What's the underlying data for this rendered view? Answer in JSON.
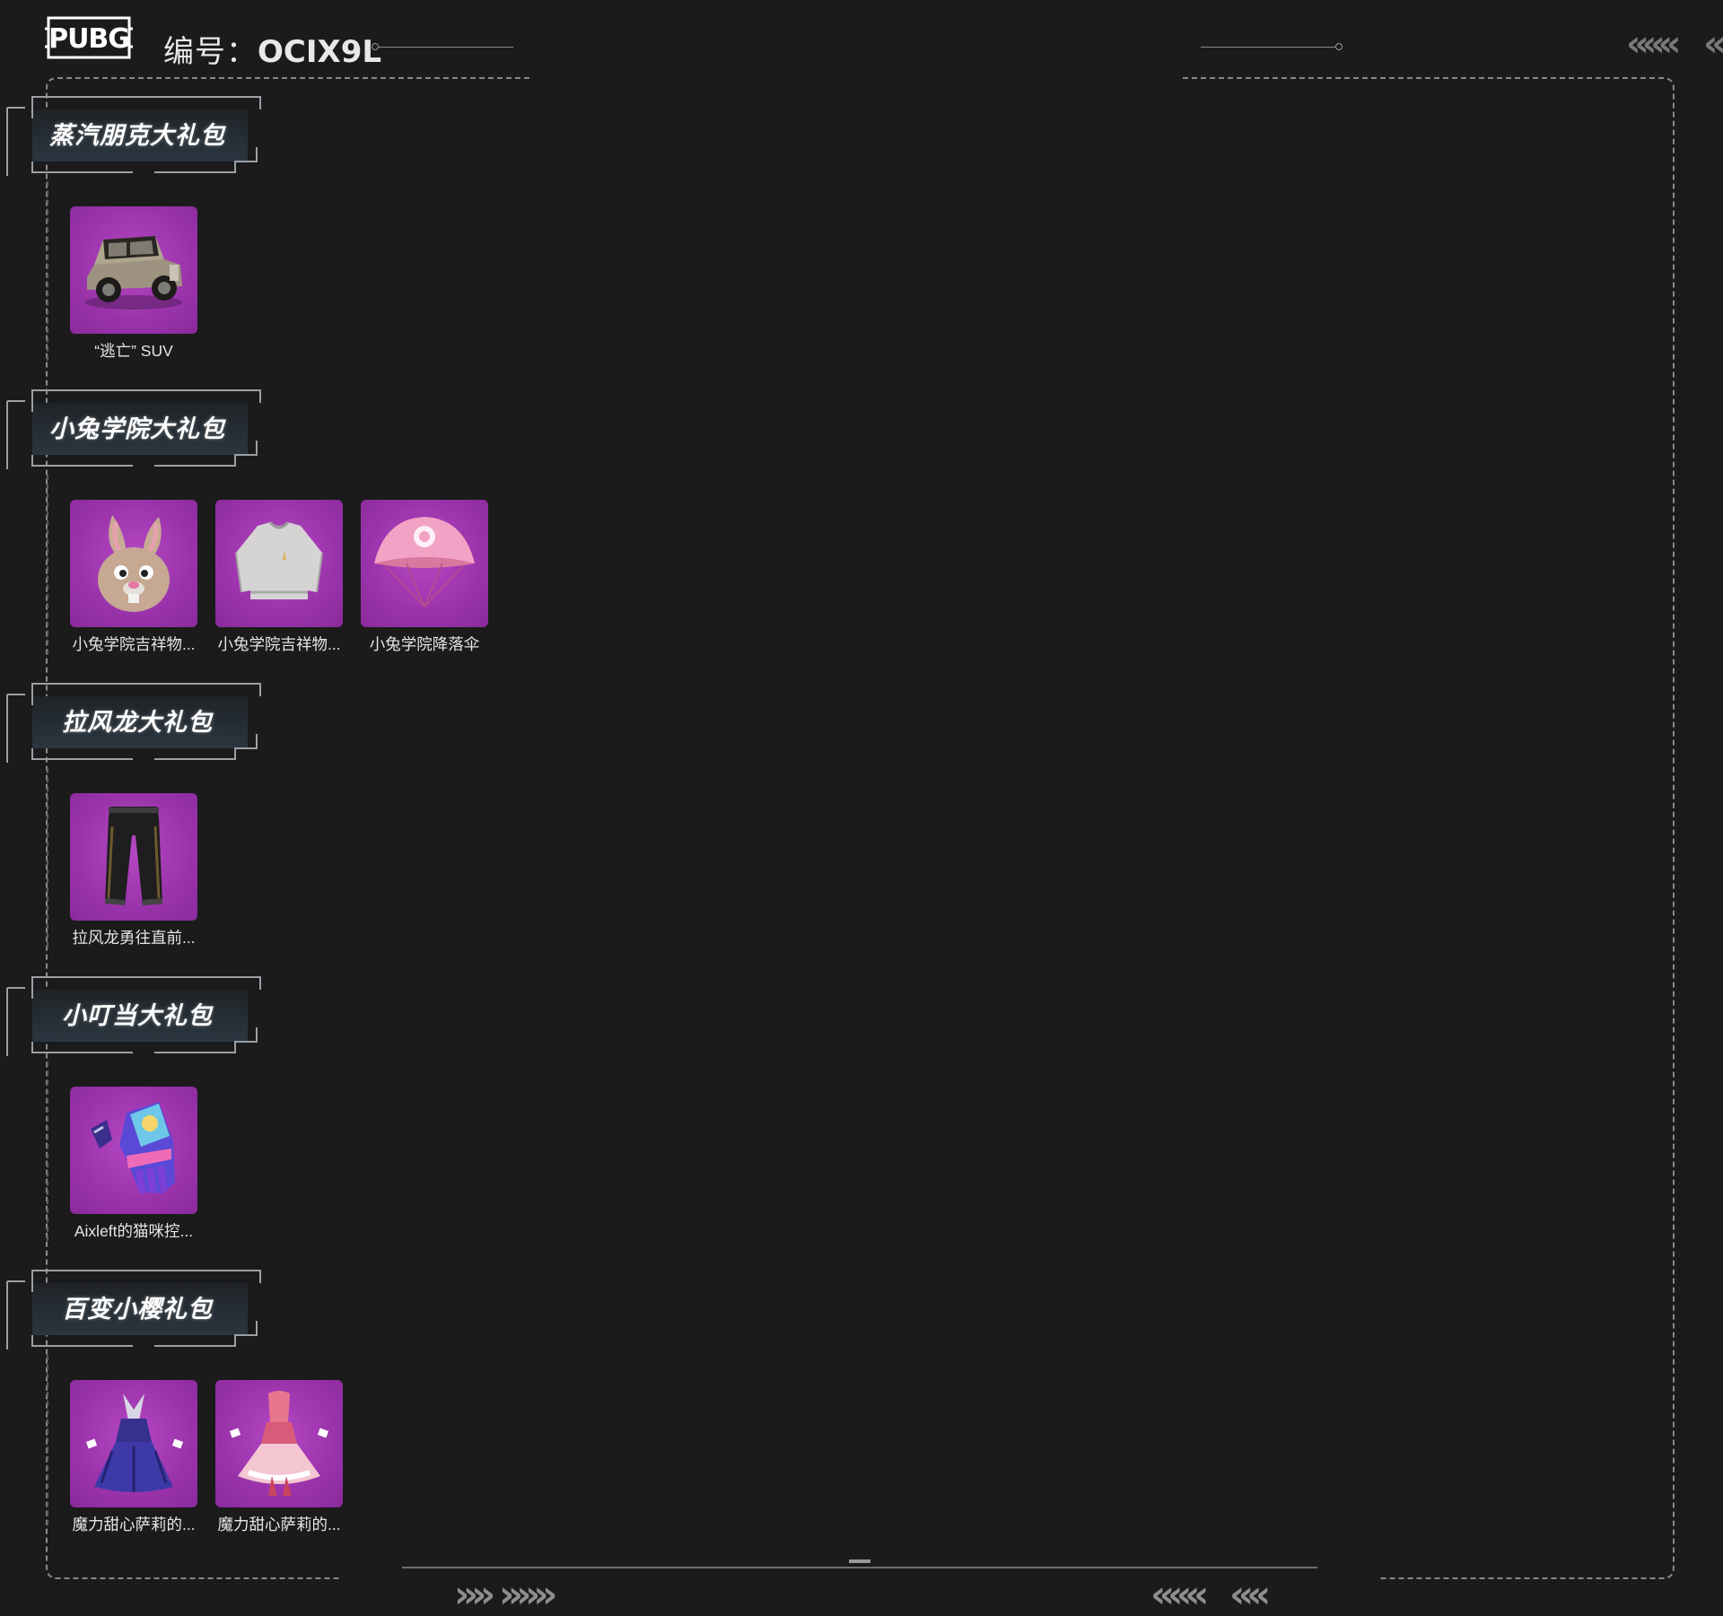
{
  "header": {
    "logo_text": "PUBG",
    "account_label": "编号：",
    "account_value": "OCIX9L"
  },
  "colors": {
    "background": "#1b1b1c",
    "tile": "#9a33aa",
    "frame_line": "#8a8a8a"
  },
  "sections": [
    {
      "title": "蒸汽朋克大礼包",
      "items": [
        {
          "label": "“逃亡” SUV",
          "icon": "car-icon"
        }
      ]
    },
    {
      "title": "小兔学院大礼包",
      "items": [
        {
          "label": "小兔学院吉祥物...",
          "icon": "bunny-mask-icon"
        },
        {
          "label": "小兔学院吉祥物...",
          "icon": "sweater-icon"
        },
        {
          "label": "小兔学院降落伞",
          "icon": "parachute-icon"
        }
      ]
    },
    {
      "title": "拉风龙大礼包",
      "items": [
        {
          "label": "拉风龙勇往直前...",
          "icon": "pants-icon"
        }
      ]
    },
    {
      "title": "小叮当大礼包",
      "items": [
        {
          "label": "Aixleft的猫咪控...",
          "icon": "gloves-icon"
        }
      ]
    },
    {
      "title": "百变小樱礼包",
      "items": [
        {
          "label": "魔力甜心萨莉的...",
          "icon": "dark-dress-icon"
        },
        {
          "label": "魔力甜心萨莉的...",
          "icon": "pink-dress-icon"
        }
      ]
    }
  ]
}
